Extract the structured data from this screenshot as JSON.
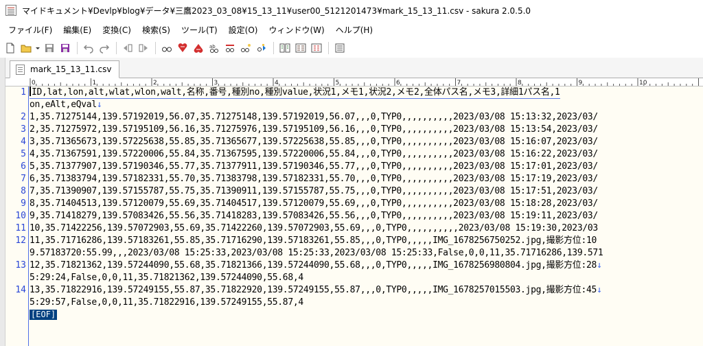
{
  "window": {
    "title": "マイドキュメント¥Devlp¥blog¥データ¥三鷹2023_03_08¥15_13_11¥user00_5121201473¥mark_15_13_11.csv - sakura 2.0.5.0"
  },
  "menu": {
    "items": [
      "ファイル(F)",
      "編集(E)",
      "変換(C)",
      "検索(S)",
      "ツール(T)",
      "設定(O)",
      "ウィンドウ(W)",
      "ヘルプ(H)"
    ]
  },
  "toolbar": {
    "buttons": [
      "new-file-icon",
      "open-folder-icon",
      "save-icon",
      "save-all-icon",
      "undo-icon",
      "redo-icon",
      "back-icon",
      "forward-icon",
      "find-icon",
      "find-next-icon",
      "find-prev-icon",
      "replace-icon",
      "grep-icon",
      "jump-icon",
      "bookmark-icon",
      "compare-icon",
      "outline-icon",
      "print-icon",
      "settings-icon"
    ]
  },
  "tab": {
    "label": "mark_15_13_11.csv"
  },
  "ruler": {
    "marks": [
      "0",
      "1",
      "2",
      "3",
      "4",
      "5",
      "6",
      "7",
      "8",
      "9",
      "10"
    ]
  },
  "editor": {
    "lines": [
      {
        "num": "1",
        "text": "ID,lat,lon,alt,wlat,wlon,walt,名称,番号,種別no,種別value,状況1,メモ1,状況2,メモ2,全体パス名,メモ3,詳細1パス名,1"
      },
      {
        "num": "",
        "text": "on,eAlt,eQval"
      },
      {
        "num": "2",
        "text": "1,35.71275144,139.57192019,56.07,35.71275148,139.57192019,56.07,,,0,TYP0,,,,,,,,,,2023/03/08 15:13:32,2023/03/"
      },
      {
        "num": "3",
        "text": "2,35.71275972,139.57195109,56.16,35.71275976,139.57195109,56.16,,,0,TYP0,,,,,,,,,,2023/03/08 15:13:54,2023/03/"
      },
      {
        "num": "4",
        "text": "3,35.71365673,139.57225638,55.85,35.71365677,139.57225638,55.85,,,0,TYP0,,,,,,,,,,2023/03/08 15:16:07,2023/03/"
      },
      {
        "num": "5",
        "text": "4,35.71367591,139.57220006,55.84,35.71367595,139.57220006,55.84,,,0,TYP0,,,,,,,,,,2023/03/08 15:16:22,2023/03/"
      },
      {
        "num": "6",
        "text": "5,35.71377907,139.57190346,55.77,35.71377911,139.57190346,55.77,,,0,TYP0,,,,,,,,,,2023/03/08 15:17:01,2023/03/"
      },
      {
        "num": "7",
        "text": "6,35.71383794,139.57182331,55.70,35.71383798,139.57182331,55.70,,,0,TYP0,,,,,,,,,,2023/03/08 15:17:19,2023/03/"
      },
      {
        "num": "8",
        "text": "7,35.71390907,139.57155787,55.75,35.71390911,139.57155787,55.75,,,0,TYP0,,,,,,,,,,2023/03/08 15:17:51,2023/03/"
      },
      {
        "num": "9",
        "text": "8,35.71404513,139.57120079,55.69,35.71404517,139.57120079,55.69,,,0,TYP0,,,,,,,,,,2023/03/08 15:18:28,2023/03/"
      },
      {
        "num": "10",
        "text": "9,35.71418279,139.57083426,55.56,35.71418283,139.57083426,55.56,,,0,TYP0,,,,,,,,,,2023/03/08 15:19:11,2023/03/"
      },
      {
        "num": "11",
        "text": "10,35.71422256,139.57072903,55.69,35.71422260,139.57072903,55.69,,,0,TYP0,,,,,,,,,,2023/03/08 15:19:30,2023/03"
      },
      {
        "num": "12",
        "text": "11,35.71716286,139.57183261,55.85,35.71716290,139.57183261,55.85,,,0,TYP0,,,,,IMG_1678256750252.jpg,撮影方位:10"
      },
      {
        "num": "",
        "text": "9.57183720:55.99,,,2023/03/08 15:25:33,2023/03/08 15:25:33,2023/03/08 15:25:33,False,0,0,11,35.71716286,139.571"
      },
      {
        "num": "13",
        "text": "12,35.71821362,139.57244090,55.68,35.71821366,139.57244090,55.68,,,0,TYP0,,,,,IMG_1678256980804.jpg,撮影方位:28"
      },
      {
        "num": "",
        "text": "5:29:24,False,0,0,11,35.71821362,139.57244090,55.68,4"
      },
      {
        "num": "14",
        "text": "13,35.71822916,139.57249155,55.87,35.71822920,139.57249155,55.87,,,0,TYP0,,,,,IMG_1678257015503.jpg,撮影方位:45"
      },
      {
        "num": "",
        "text": "5:29:57,False,0,0,11,35.71822916,139.57249155,55.87,4"
      }
    ],
    "newline_marks": [
      false,
      true,
      false,
      false,
      false,
      false,
      false,
      false,
      false,
      false,
      false,
      false,
      false,
      false,
      true,
      false,
      true
    ],
    "newline_glyph": "↓",
    "eof": "[EOF]"
  },
  "colors": {
    "line_number": "#2a46d6",
    "editor_bg": "#fffdf4",
    "eof_bg": "#004080",
    "newline_mark": "#3a63f0"
  }
}
